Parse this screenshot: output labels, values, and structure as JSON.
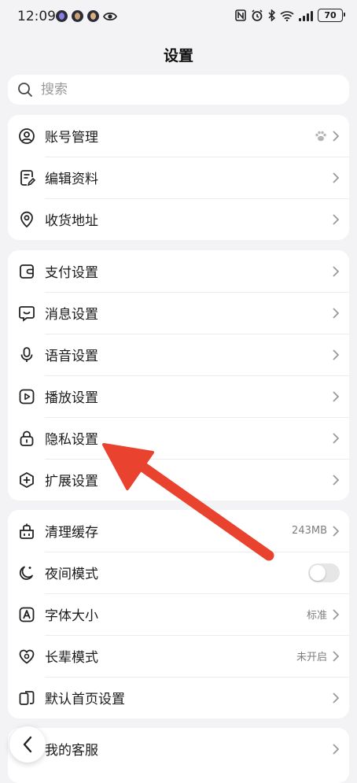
{
  "status_bar": {
    "time": "12:09",
    "battery": "70"
  },
  "header": {
    "title": "设置"
  },
  "search": {
    "placeholder": "搜索"
  },
  "group1": [
    {
      "label": "账号管理",
      "icon": "account-icon"
    },
    {
      "label": "编辑资料",
      "icon": "edit-profile-icon"
    },
    {
      "label": "收货地址",
      "icon": "location-icon"
    }
  ],
  "group2": [
    {
      "label": "支付设置",
      "icon": "wallet-icon"
    },
    {
      "label": "消息设置",
      "icon": "message-icon"
    },
    {
      "label": "语音设置",
      "icon": "microphone-icon"
    },
    {
      "label": "播放设置",
      "icon": "play-icon"
    },
    {
      "label": "隐私设置",
      "icon": "lock-icon"
    },
    {
      "label": "扩展设置",
      "icon": "extension-icon"
    }
  ],
  "group3": [
    {
      "label": "清理缓存",
      "icon": "clean-icon",
      "value": "243MB"
    },
    {
      "label": "夜间模式",
      "icon": "night-mode-icon",
      "toggle": false
    },
    {
      "label": "字体大小",
      "icon": "font-size-icon",
      "value": "标准"
    },
    {
      "label": "长辈模式",
      "icon": "elder-mode-icon",
      "value": "未开启"
    },
    {
      "label": "默认首页设置",
      "icon": "homepage-icon"
    }
  ],
  "group4": [
    {
      "label": "我的客服",
      "icon": "customer-service-icon"
    }
  ],
  "annotation": {
    "arrow_color": "#e9432f"
  }
}
